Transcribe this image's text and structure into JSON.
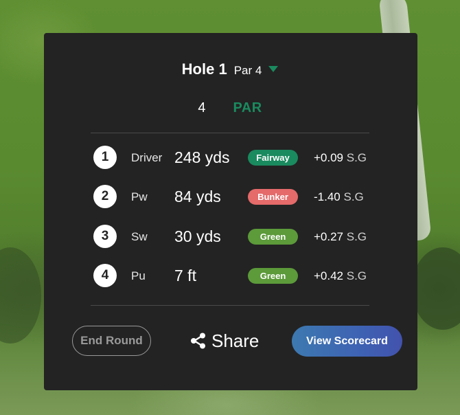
{
  "hole": {
    "title": "Hole 1",
    "par_label": "Par 4"
  },
  "score": {
    "strokes": "4",
    "result": "PAR",
    "result_color": "#1a8a5f"
  },
  "shots": [
    {
      "num": "1",
      "club": "Driver",
      "distance": "248 yds",
      "lie": "Fairway",
      "lie_color": "#1a8a5f",
      "sg_value": "+0.09",
      "sg_unit": "S.G"
    },
    {
      "num": "2",
      "club": "Pw",
      "distance": "84 yds",
      "lie": "Bunker",
      "lie_color": "#e56a6a",
      "sg_value": "-1.40",
      "sg_unit": "S.G"
    },
    {
      "num": "3",
      "club": "Sw",
      "distance": "30 yds",
      "lie": "Green",
      "lie_color": "#5c9a3a",
      "sg_value": "+0.27",
      "sg_unit": "S.G"
    },
    {
      "num": "4",
      "club": "Pu",
      "distance": "7 ft",
      "lie": "Green",
      "lie_color": "#5c9a3a",
      "sg_value": "+0.42",
      "sg_unit": "S.G"
    }
  ],
  "actions": {
    "end_round": "End Round",
    "share": "Share",
    "share_icon": "share-icon",
    "view_scorecard": "View Scorecard"
  },
  "colors": {
    "panel_bg": "#232323",
    "accent": "#1a8a5f",
    "button_gradient_start": "#3d79b0",
    "button_gradient_end": "#4252ad"
  }
}
